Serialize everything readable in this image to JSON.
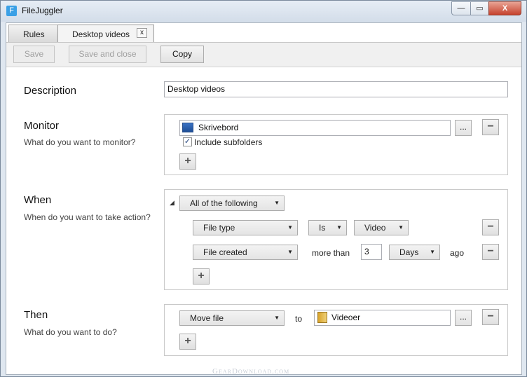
{
  "window": {
    "app_icon_letter": "F",
    "title": "FileJuggler",
    "min": "—",
    "max": "▭",
    "close": "X"
  },
  "tabs": [
    {
      "label": "Rules"
    },
    {
      "label": "Desktop videos",
      "close": "x"
    }
  ],
  "toolbar": {
    "save": "Save",
    "save_and_close": "Save and close",
    "copy": "Copy"
  },
  "description": {
    "label": "Description",
    "value": "Desktop videos"
  },
  "monitor": {
    "title": "Monitor",
    "subtitle": "What do you want to monitor?",
    "folder": "Skrivebord",
    "browse": "...",
    "include_subfolders_label": "Include subfolders",
    "include_subfolders_checked": "✓",
    "remove": "−",
    "add": "+"
  },
  "when": {
    "title": "When",
    "subtitle": "When do you want to take action?",
    "group_mode": "All of the following",
    "conditions": [
      {
        "field": "File type",
        "operator": "Is",
        "value": "Video"
      },
      {
        "field": "File created",
        "operator": "more than",
        "amount": "3",
        "unit": "Days",
        "suffix": "ago"
      }
    ],
    "remove": "−",
    "add": "+"
  },
  "then": {
    "title": "Then",
    "subtitle": "What do you want to do?",
    "action": "Move file",
    "to_label": "to",
    "destination": "Videoer",
    "browse": "...",
    "remove": "−",
    "add": "+"
  },
  "watermark": "GearDownload.com"
}
